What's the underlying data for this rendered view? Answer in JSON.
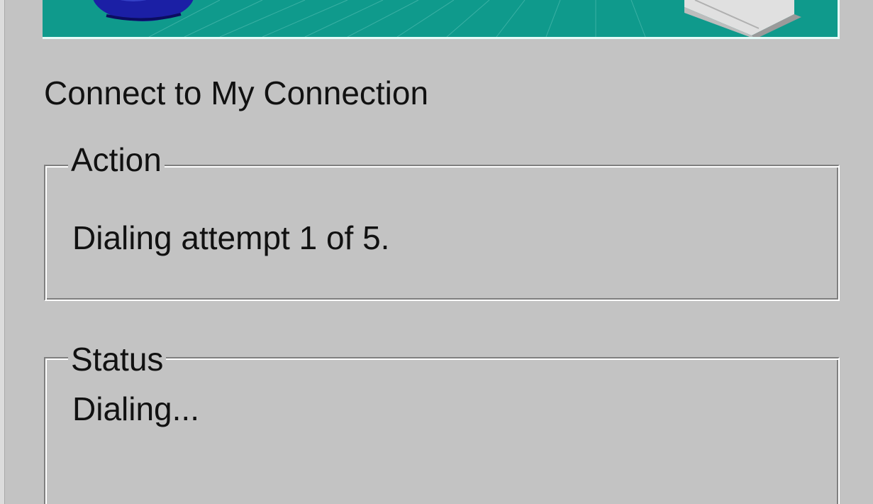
{
  "window": {
    "title": "Connect to My Connection"
  },
  "banner": {
    "icons": [
      "globe-icon",
      "computer-icon"
    ],
    "color": "#0f9a8c"
  },
  "action_group": {
    "legend": "Action",
    "text": "Dialing attempt 1 of 5."
  },
  "status_group": {
    "legend": "Status",
    "text": "Dialing..."
  }
}
